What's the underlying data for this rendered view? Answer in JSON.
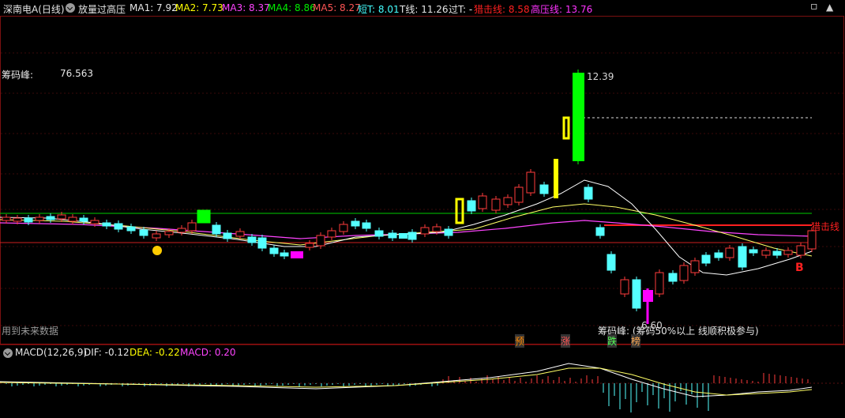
{
  "header": {
    "stock": "深南电A(日线)",
    "indicator": "放量过高压",
    "ma1": "MA1: 7.92",
    "ma2": "MA2: 7.73",
    "ma3": "MA3: 8.37",
    "ma4": "MA4: 8.86",
    "ma5": "MA5: 8.27",
    "short_t": "短T: 8.01",
    "t_line": "T线: 11.26",
    "guo_t": "过T: -",
    "ambush": "猎击线: 8.58",
    "high_press": "高压线: 13.76"
  },
  "main": {
    "chip_label": "筹码峰:",
    "chip_value": "76.563",
    "high_price": "12.39",
    "future_note": "用到未来数据",
    "ambush_tag": "猎击线",
    "buy_tag": "B",
    "chip_note": "筹码峰: (筹码50%以上 线顺积极参与)",
    "low_price": "6.60",
    "event_tags": [
      "预",
      "涨",
      "跌",
      "榜"
    ]
  },
  "macd": {
    "title": "MACD(12,26,9)",
    "dif": "DIF: -0.12",
    "dea": "DEA: -0.22",
    "macd": "MACD: 0.20"
  },
  "colors": {
    "up": "#ff3c3c",
    "down": "#54ffff",
    "yellow": "#ffff00",
    "green_bar": "#00ff00",
    "magenta": "#ff00ff",
    "ma3": "#ff44ff",
    "ma4": "#00ee00",
    "ma5": "#ff5555",
    "short_t": "#44ffff",
    "ambush": "#ff2020",
    "high_press": "#ff33ff"
  }
}
